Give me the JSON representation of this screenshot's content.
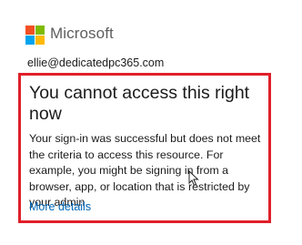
{
  "brand": {
    "name": "Microsoft",
    "logo_colors": [
      "#f25022",
      "#7fba00",
      "#00a4ef",
      "#ffb900"
    ]
  },
  "account": {
    "email": "ellie@dedicatedpc365.com"
  },
  "error": {
    "title": "You cannot access this right now",
    "message": "Your sign-in was successful but does not meet the criteria to access this resource. For example, you might be signing in from a browser, app, or location that is restricted by your admin.",
    "more_details_label": "More details",
    "border_color": "#e0202a"
  },
  "icons": {
    "cursor": "mouse-pointer-icon"
  }
}
